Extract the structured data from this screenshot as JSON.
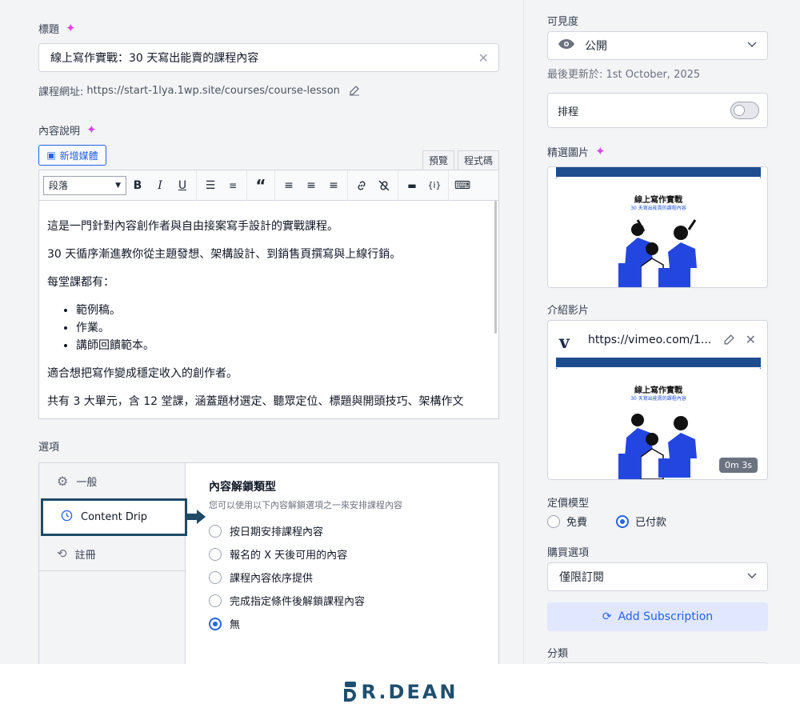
{
  "title_field": {
    "label": "標題",
    "value": "線上寫作實戰：30 天寫出能賣的課程內容"
  },
  "course_url": {
    "prefix": "課程網址:",
    "url": "https://start-1lya.1wp.site/courses/course-lesson"
  },
  "description": {
    "label": "內容說明",
    "add_media": "新增媒體",
    "tab_preview": "預覽",
    "tab_code": "程式碼",
    "format_select": "段落",
    "paragraphs": [
      "這是一門針對內容創作者與自由接案寫手設計的實戰課程。",
      "30 天循序漸進教你從主題發想、架構設計、到銷售頁撰寫與上線行銷。",
      "每堂課都有："
    ],
    "bullets": [
      "範例稿。",
      "作業。",
      "講師回饋範本。"
    ],
    "closing": "適合想把寫作變成穩定收入的創作者。",
    "cutoff": "共有 3 大單元，含 12 堂課，涵蓋題材選定、聽眾定位、標題與開頭技巧、架構作文"
  },
  "options": {
    "label": "選項",
    "tabs": [
      {
        "label": "一般",
        "icon": "gear-icon"
      },
      {
        "label": "Content Drip",
        "icon": "clock-icon"
      },
      {
        "label": "註冊",
        "icon": "refresh-icon"
      }
    ],
    "drip": {
      "title": "內容解鎖類型",
      "subtitle": "您可以使用以下內容解鎖選項之一來安排課程內容",
      "choices": [
        "按日期安排課程內容",
        "報名的 X 天後可用的內容",
        "課程內容依序提供",
        "完成指定條件後解鎖課程內容",
        "無"
      ],
      "selected": 4
    }
  },
  "sidebar": {
    "visibility": {
      "label": "可見度",
      "value": "公開",
      "updated": "最後更新於: 1st October, 2025"
    },
    "schedule": {
      "label": "排程",
      "on": false
    },
    "featured_image": {
      "label": "精選圖片",
      "thumb_title": "線上寫作實戰",
      "thumb_subtitle": "30 天寫出能賣的課程內容"
    },
    "intro_video": {
      "label": "介紹影片",
      "url": "https://vimeo.com/1...",
      "duration": "0m 3s",
      "thumb_title": "線上寫作實戰",
      "thumb_subtitle": "30 天寫出能賣的課程內容"
    },
    "pricing": {
      "label": "定價模型",
      "free": "免費",
      "paid": "已付款",
      "selected": "paid"
    },
    "purchase": {
      "label": "購買選項",
      "value": "僅限訂閱",
      "add_button": "Add Subscription"
    },
    "category": {
      "label": "分類"
    }
  },
  "footer": {
    "logo": "R.DEAN"
  },
  "colors": {
    "accent": "#2563eb",
    "brand": "#1e4a66",
    "sparkle": "#d946ef"
  }
}
